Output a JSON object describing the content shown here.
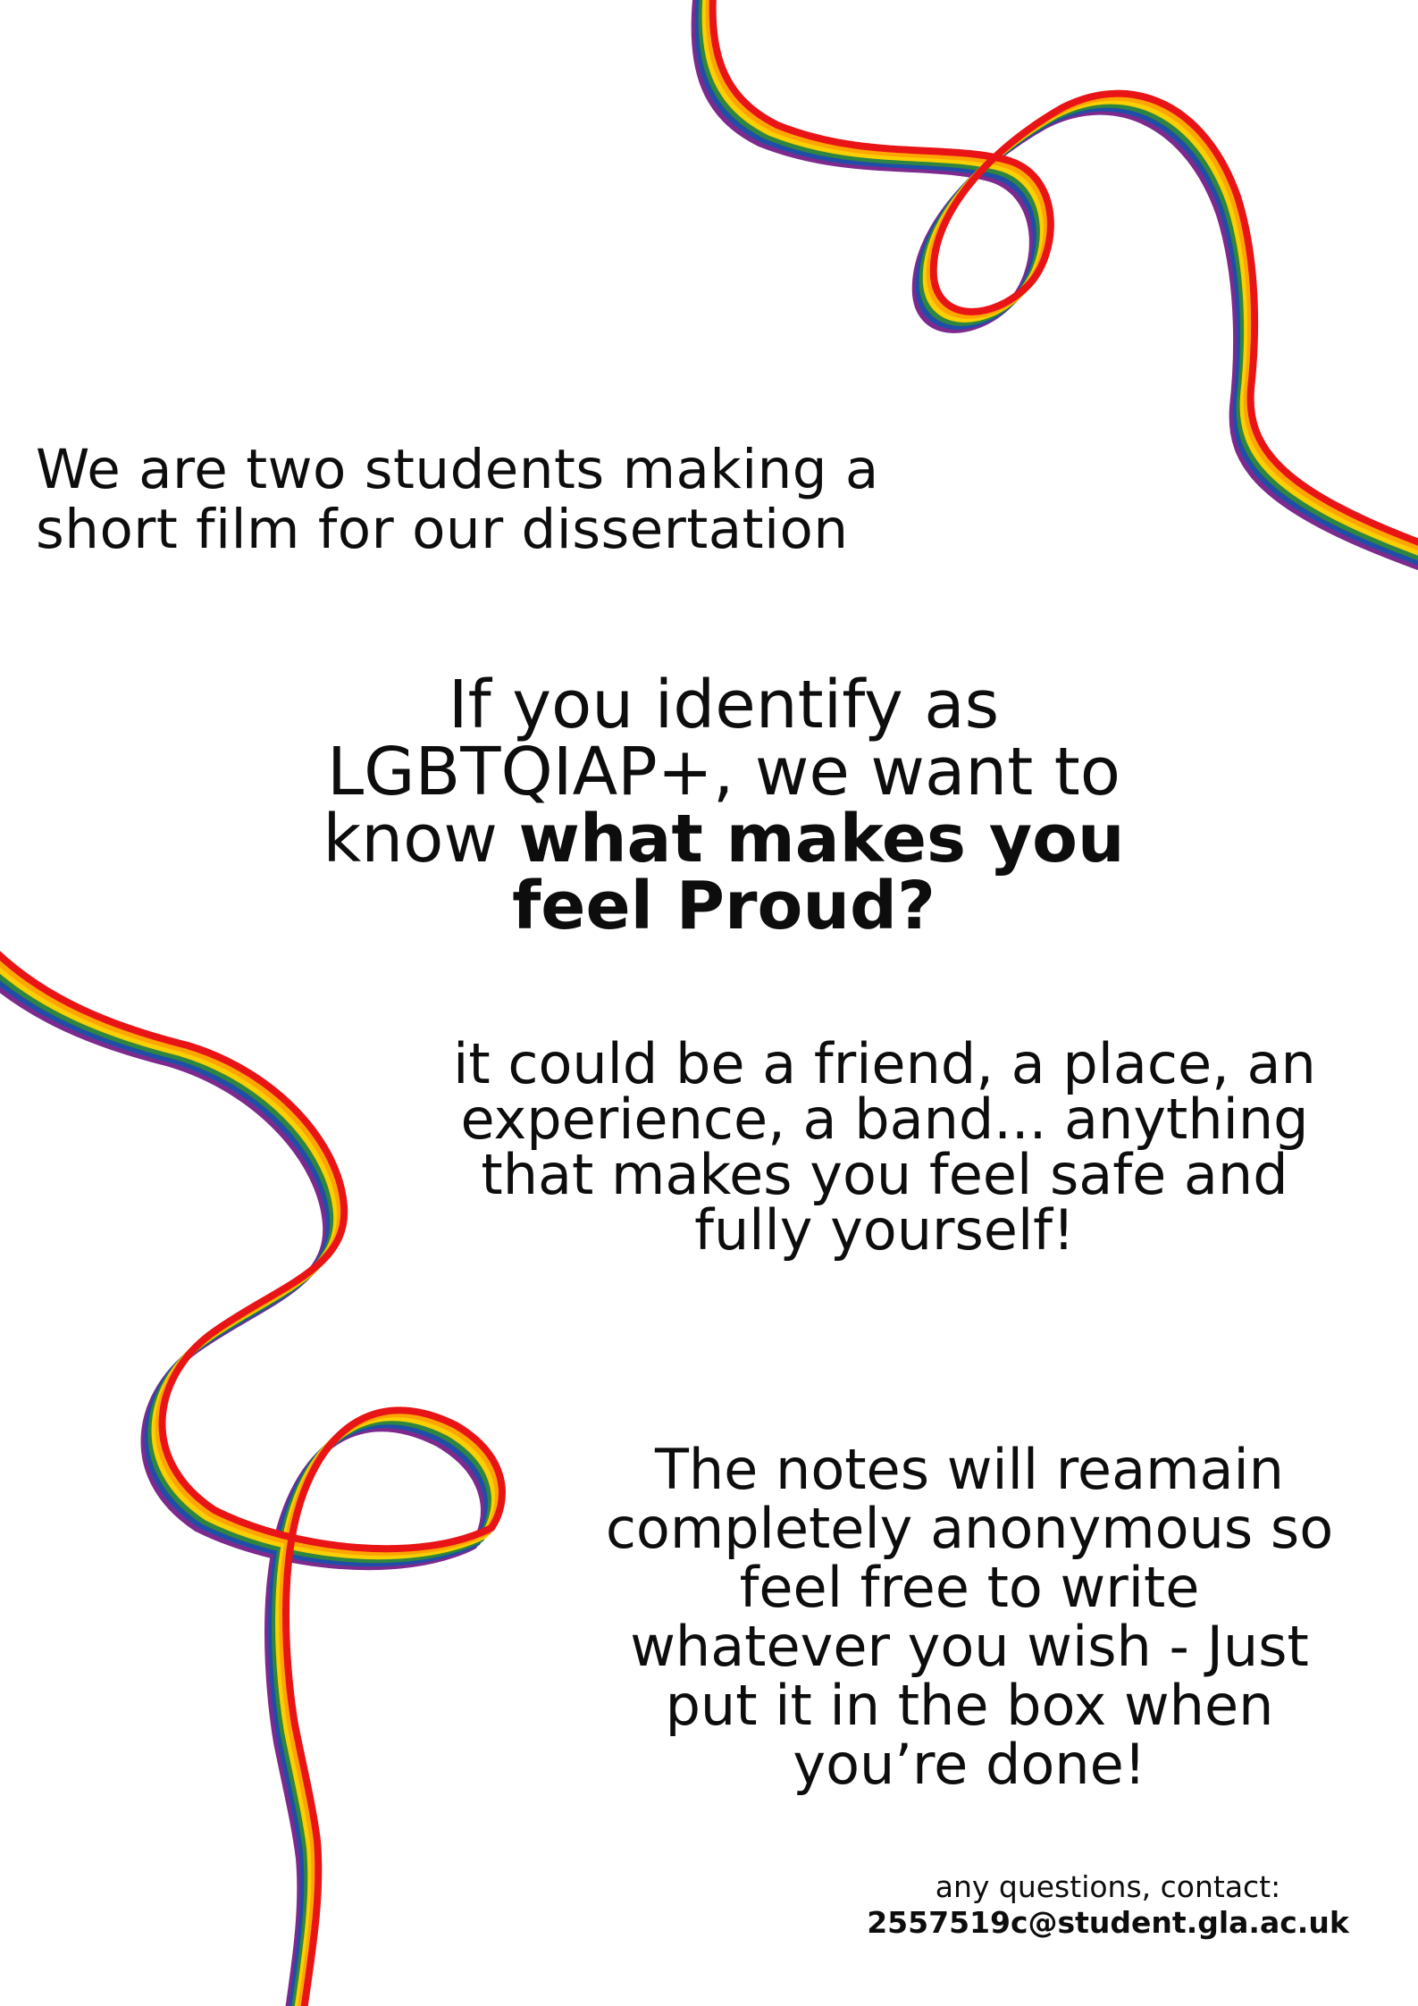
{
  "intro": {
    "line1": "We are two students making a",
    "line2": "short film for our dissertation"
  },
  "headline": {
    "line1": "If you identify as",
    "line2": "LGBTQIAP+, we want to",
    "line3_prefix": "know ",
    "line3_bold": "what makes you",
    "line4": "feel Proud?"
  },
  "examples": {
    "line1": "it could be a friend, a place, an",
    "line2": "experience, a band... anything",
    "line3": "that makes you feel safe and",
    "line4": "fully yourself!"
  },
  "anonymous": {
    "line1": "The notes will reamain",
    "line2": "completely anonymous so",
    "line3": "feel free to write",
    "line4": "whatever you wish -  Just",
    "line5": "put it in the box when",
    "line6": "you’re done!"
  },
  "contact": {
    "label": "any questions, contact:",
    "email": "2557519c@student.gla.ac.uk"
  },
  "ribbon_colors": [
    "#e81416",
    "#ffa500",
    "#fad000",
    "#2e8540",
    "#1f4ea8",
    "#7d2a8e"
  ]
}
